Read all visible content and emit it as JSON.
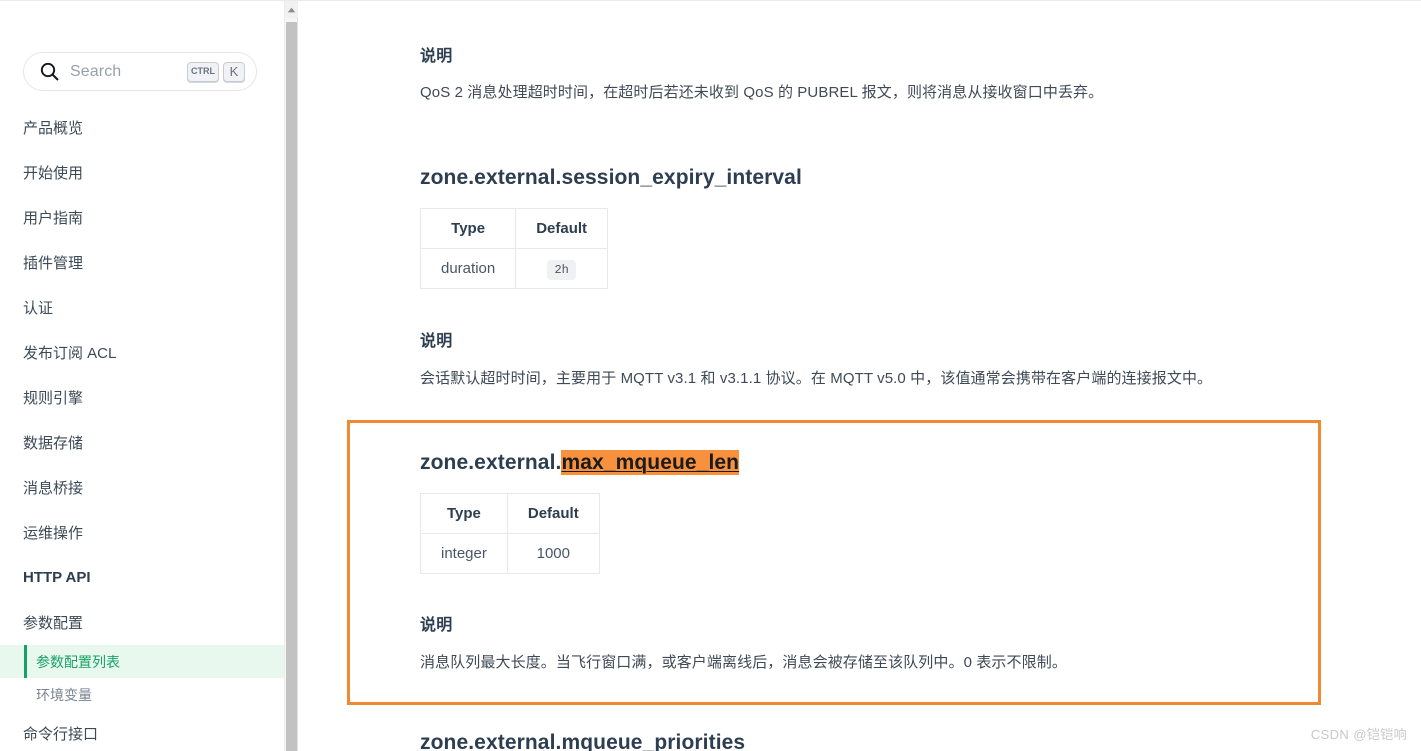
{
  "sidebar": {
    "search": {
      "placeholder": "Search",
      "icon": "search-icon",
      "shortcut_keys": [
        "CTRL",
        "K"
      ]
    },
    "items": [
      {
        "label": "产品概览",
        "type": "item",
        "strong": false
      },
      {
        "label": "开始使用",
        "type": "item",
        "strong": false
      },
      {
        "label": "用户指南",
        "type": "item",
        "strong": false
      },
      {
        "label": "插件管理",
        "type": "item",
        "strong": false
      },
      {
        "label": "认证",
        "type": "item",
        "strong": false
      },
      {
        "label": "发布订阅 ACL",
        "type": "item",
        "strong": false
      },
      {
        "label": "规则引擎",
        "type": "item",
        "strong": false
      },
      {
        "label": "数据存储",
        "type": "item",
        "strong": false
      },
      {
        "label": "消息桥接",
        "type": "item",
        "strong": false
      },
      {
        "label": "运维操作",
        "type": "item",
        "strong": false
      },
      {
        "label": "HTTP API",
        "type": "item",
        "strong": true
      },
      {
        "label": "参数配置",
        "type": "item",
        "strong": false
      },
      {
        "label": "参数配置列表",
        "type": "sub",
        "active": true
      },
      {
        "label": "环境变量",
        "type": "sub",
        "active": false
      },
      {
        "label": "命令行接口",
        "type": "item",
        "strong": false
      }
    ],
    "scrollbar": {
      "name": "sidebar-scrollbar",
      "arrow": "chevron-up-icon"
    }
  },
  "content": {
    "section_heading_label": "说明",
    "block1": {
      "description_heading": "说明",
      "description_text": "QoS 2 消息处理超时时间，在超时后若还未收到 QoS 的 PUBREL 报文，则将消息从接收窗口中丢弃。"
    },
    "block2": {
      "param_name": "zone.external.session_expiry_interval",
      "table": {
        "headers": [
          "Type",
          "Default"
        ],
        "rows": [
          [
            "duration",
            "2h"
          ]
        ],
        "default_is_code": true
      },
      "description_heading": "说明",
      "description_text": "会话默认超时时间，主要用于 MQTT v3.1 和 v3.1.1 协议。在 MQTT v5.0 中，该值通常会携带在客户端的连接报文中。"
    },
    "block3_highlighted": {
      "param_prefix": "zone.external.",
      "param_highlight": "max_mqueue_len",
      "table": {
        "headers": [
          "Type",
          "Default"
        ],
        "rows": [
          [
            "integer",
            "1000"
          ]
        ],
        "default_is_code": false
      },
      "description_heading": "说明",
      "description_text": "消息队列最大长度。当飞行窗口满，或客户端离线后，消息会被存储至该队列中。0 表示不限制。",
      "highlight_color": "#f7913d",
      "callout_border_color": "#f08a32"
    },
    "block4": {
      "param_name": "zone.external.mqueue_priorities"
    }
  },
  "watermark": {
    "text": "CSDN @铠铠响"
  },
  "colors": {
    "accent_green": "#17a167",
    "active_bg": "#e8f8ef",
    "highlight_orange": "#f7913d",
    "callout_orange": "#f08a32",
    "text_primary": "#2c3e50",
    "text_body": "#3f4a56",
    "border": "#e6e8ea"
  }
}
